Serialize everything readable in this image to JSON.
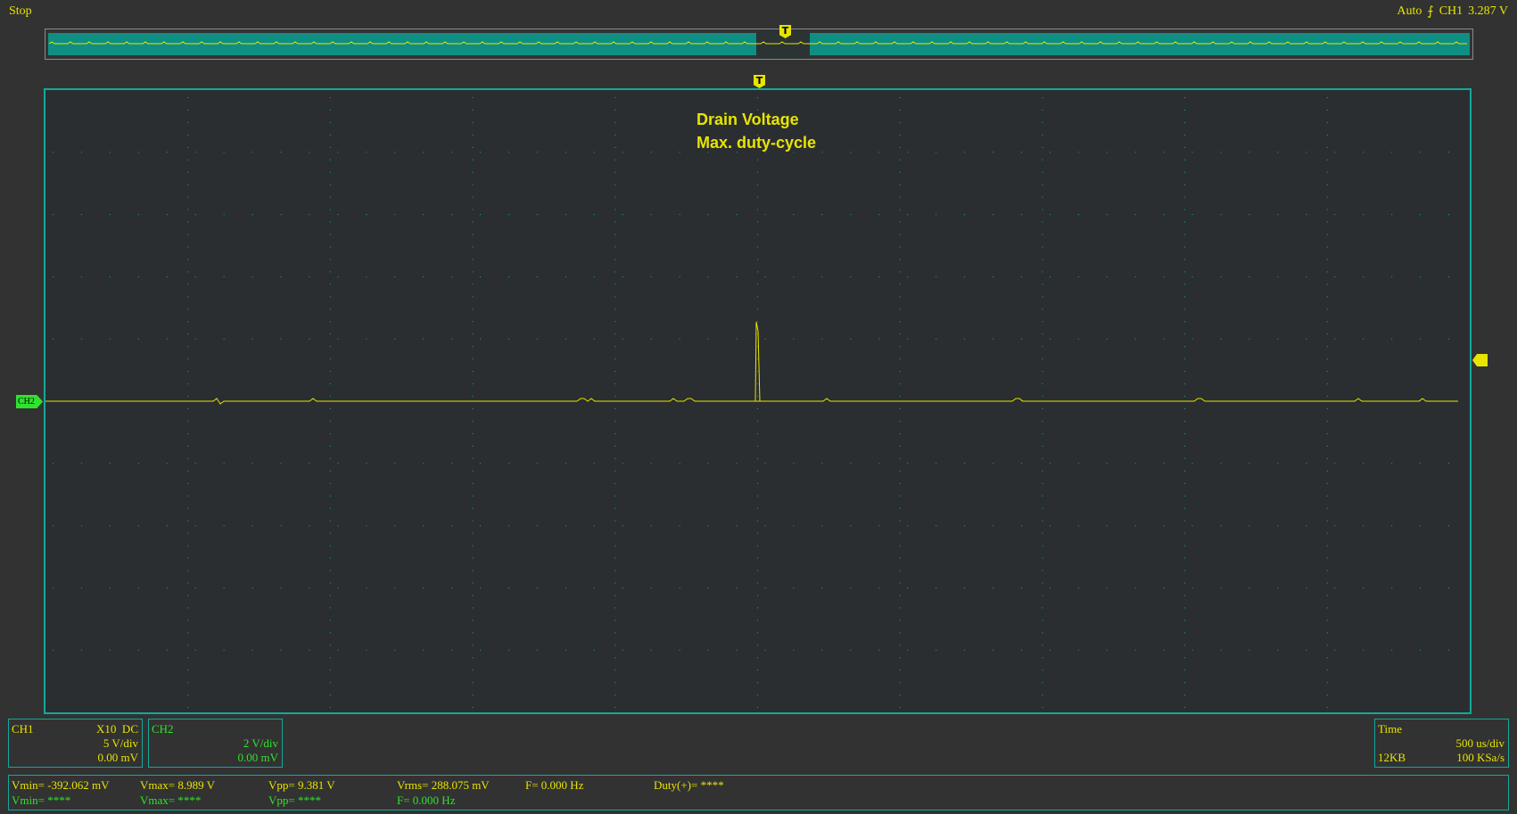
{
  "status": {
    "run_state": "Stop",
    "trigger_mode": "Auto",
    "trigger_edge_icon": "rising-edge-icon",
    "trigger_channel": "CH1",
    "trigger_level": "3.287 V"
  },
  "markers": {
    "trigger_label": "T",
    "ch2_label": "CH2"
  },
  "annotation": {
    "line1": "Drain Voltage",
    "line2": "Max. duty-cycle"
  },
  "ch1": {
    "name": "CH1",
    "probe": "X10  DC",
    "scale": "5 V/div",
    "offset": "0.00 mV"
  },
  "ch2": {
    "name": "CH2",
    "scale": "2 V/div",
    "offset": "0.00 mV"
  },
  "timebase": {
    "label": "Time",
    "scale": "500 us/div",
    "memory": "12KB",
    "sample_rate": "100 KSa/s"
  },
  "measurements": {
    "ch1": {
      "vmin": "Vmin= -392.062 mV",
      "vmax": "Vmax= 8.989 V",
      "vpp": "Vpp= 9.381 V",
      "vrms": "Vrms= 288.075 mV",
      "freq": "F= 0.000 Hz",
      "duty": "Duty(+)= ****"
    },
    "ch2": {
      "vmin": "Vmin= ****",
      "vmax": "Vmax= ****",
      "vpp": "Vpp= ****",
      "freq": "F= 0.000 Hz"
    }
  },
  "colors": {
    "ch1": "#e8e400",
    "ch2": "#2fe32f",
    "grid": "#14a89a",
    "background": "#323232"
  }
}
